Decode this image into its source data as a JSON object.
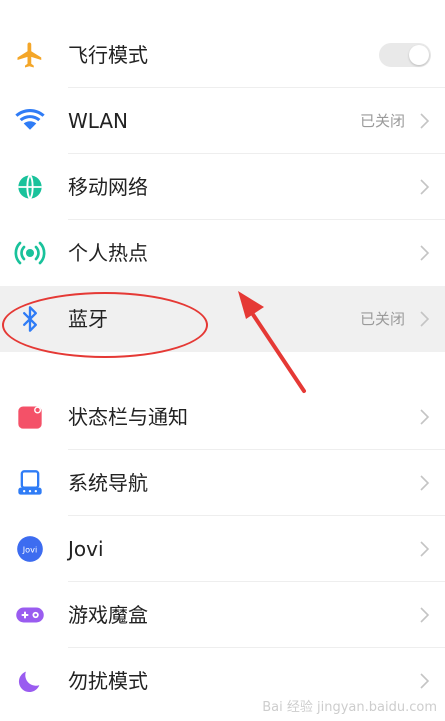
{
  "settings": {
    "items": [
      {
        "label": "飞行模式",
        "value": "",
        "icon": "airplane-icon",
        "control": "toggle",
        "toggle_on": false,
        "icon_color": "#f4a628"
      },
      {
        "label": "WLAN",
        "value": "已关闭",
        "icon": "wifi-icon",
        "control": "chevron",
        "icon_color": "#2f7cf6"
      },
      {
        "label": "移动网络",
        "value": "",
        "icon": "globe-icon",
        "control": "chevron",
        "icon_color": "#19c29b"
      },
      {
        "label": "个人热点",
        "value": "",
        "icon": "hotspot-icon",
        "control": "chevron",
        "icon_color": "#19c29b"
      },
      {
        "label": "蓝牙",
        "value": "已关闭",
        "icon": "bluetooth-icon",
        "control": "chevron",
        "highlighted": true,
        "icon_color": "#2f7cf6"
      },
      {
        "label": "状态栏与通知",
        "value": "",
        "icon": "notification-icon",
        "control": "chevron",
        "icon_color": "#f45168"
      },
      {
        "label": "系统导航",
        "value": "",
        "icon": "navigation-icon",
        "control": "chevron",
        "icon_color": "#2f7cf6"
      },
      {
        "label": "Jovi",
        "value": "",
        "icon": "jovi-icon",
        "control": "chevron",
        "icon_color": "#3d6cf0"
      },
      {
        "label": "游戏魔盒",
        "value": "",
        "icon": "game-box-icon",
        "control": "chevron",
        "icon_color": "#9a5cf0"
      },
      {
        "label": "勿扰模式",
        "value": "",
        "icon": "moon-icon",
        "control": "chevron",
        "icon_color": "#9a5cf0"
      }
    ]
  },
  "jovi_icon_text": "Jovi",
  "watermark": "Bai 经验 jingyan.baidu.com"
}
